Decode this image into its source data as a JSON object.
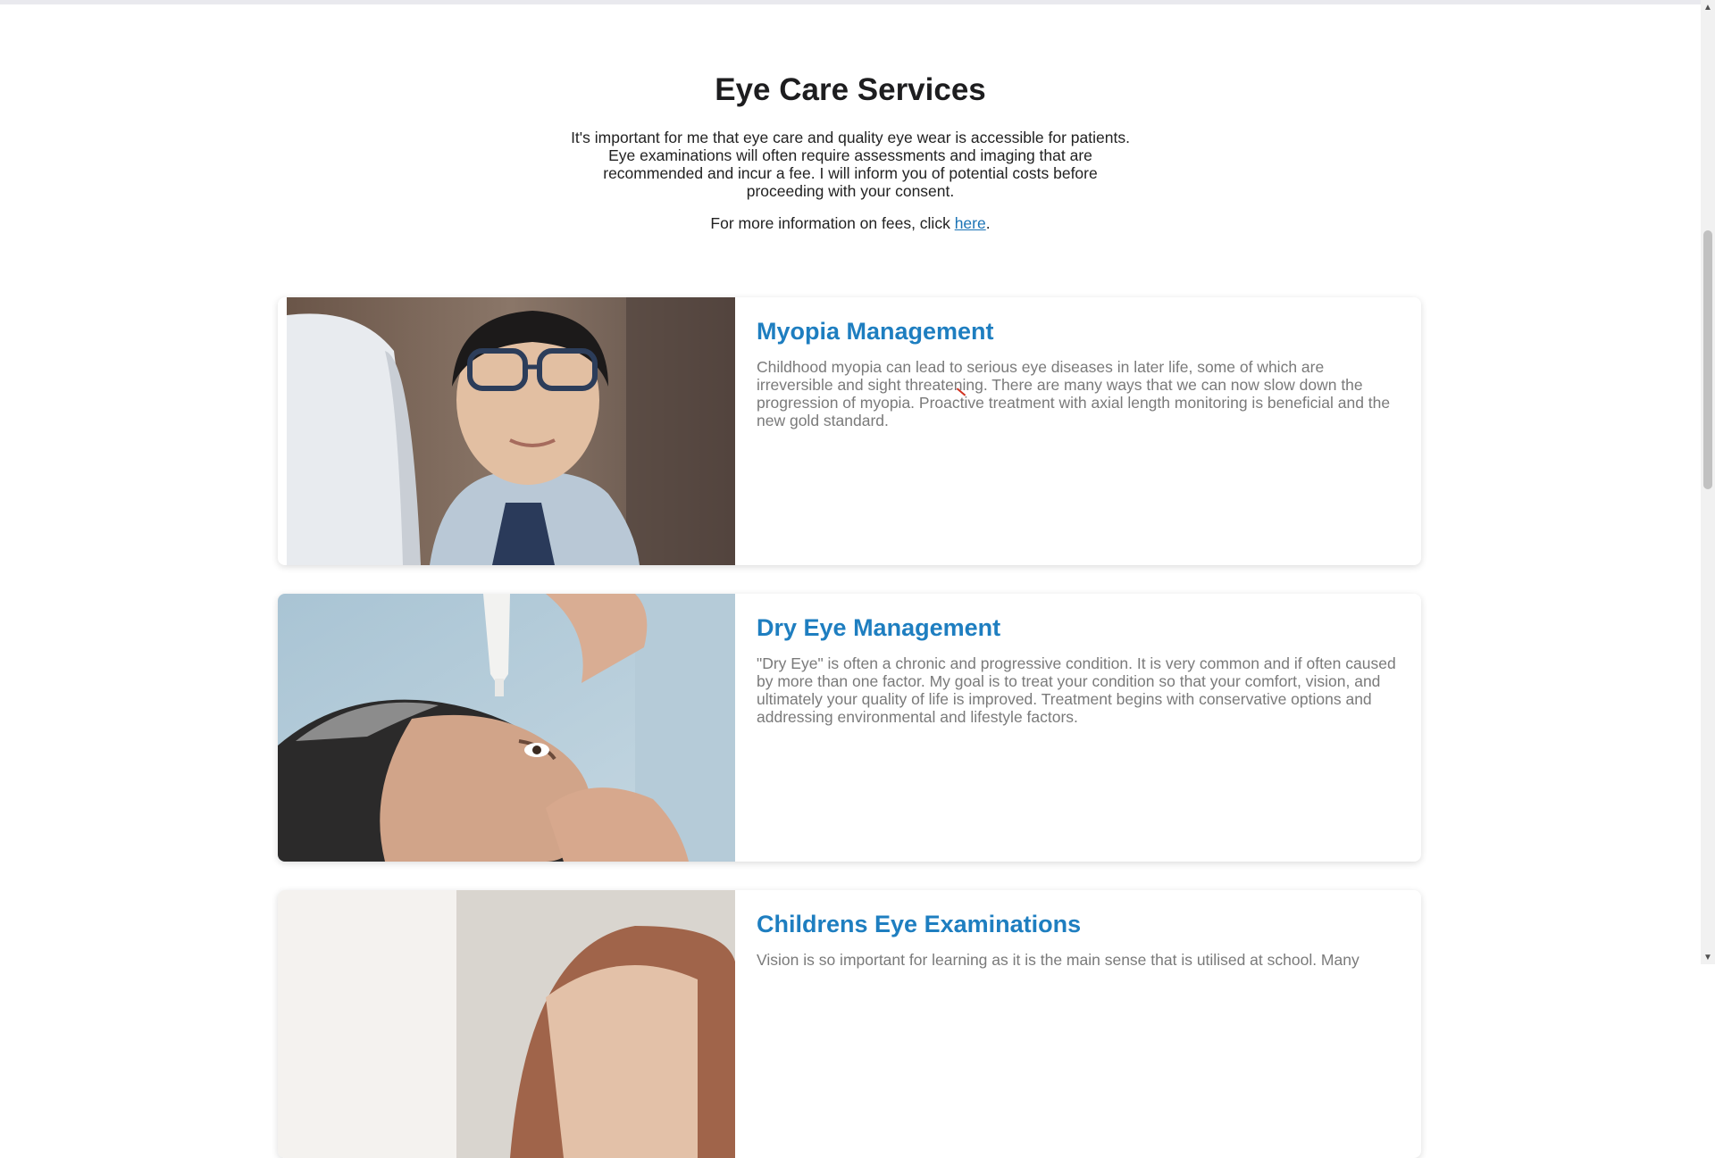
{
  "intro": {
    "title": "Eye Care Services",
    "paragraph_lines": [
      "It's important for me that eye care and quality eye wear is accessible for patients.",
      "Eye examinations will often require assessments and imaging that are",
      "recommended and incur a fee. I will inform you of potential costs before",
      "proceeding with your consent."
    ],
    "fee_prefix": "For more information on fees, click ",
    "fee_link": "here",
    "fee_suffix": "."
  },
  "services": [
    {
      "title": "Myopia Management",
      "description": "Childhood myopia can lead to serious eye diseases in later life, some of which are irreversible and sight threatening. There are many ways that we can now slow down the progression of myopia. Proactive treatment with axial length monitoring is beneficial and the new gold standard.",
      "image": "boy-with-glasses-photo"
    },
    {
      "title": "Dry Eye Management",
      "description": "\"Dry Eye\" is often a chronic and progressive condition. It is very common and if often caused by more than one factor. My goal is to treat your condition so that your comfort, vision, and ultimately your quality of life is improved. Treatment begins with conservative options and addressing environmental and lifestyle factors.",
      "image": "man-applying-eye-drops-photo"
    },
    {
      "title": "Childrens Eye Examinations",
      "description": "Vision is so important for learning as it is the main sense that is utilised at school. Many",
      "image": "child-eye-exam-photo"
    }
  ],
  "colors": {
    "heading": "#1d1d1f",
    "card_title": "#1e7ec0",
    "card_text": "#7a7a7a",
    "link": "#1a73b5"
  }
}
